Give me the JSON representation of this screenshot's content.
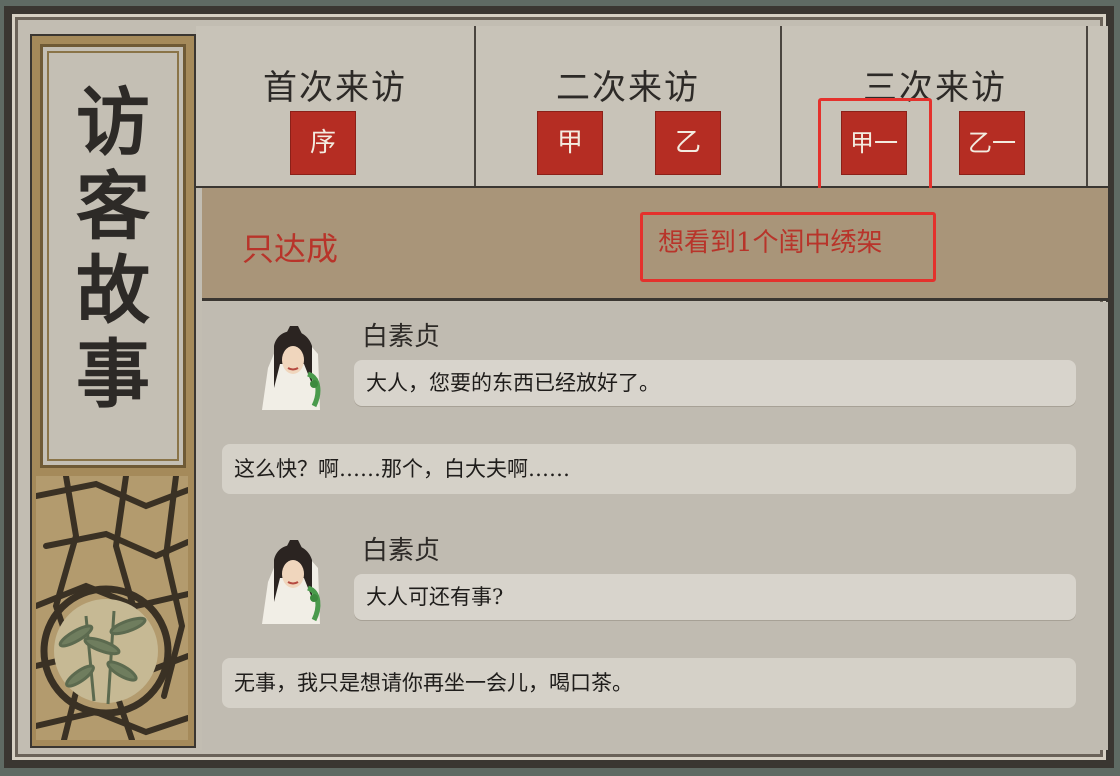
{
  "panel": {
    "title": "访\n客\n故\n事"
  },
  "visits": [
    {
      "title": "首次来访",
      "buttons": [
        "序"
      ]
    },
    {
      "title": "二次来访",
      "buttons": [
        "甲",
        "乙"
      ]
    },
    {
      "title": "三次来访",
      "buttons": [
        "甲一",
        "乙一"
      ]
    }
  ],
  "requirement": {
    "label": "只达成",
    "target": "想看到1个闺中绣架"
  },
  "dialogue": [
    {
      "speaker": "白素贞",
      "line": "大人，您要的东西已经放好了。",
      "reply": "这么快？啊……那个，白大夫啊……"
    },
    {
      "speaker": "白素贞",
      "line": "大人可还有事?",
      "reply": "无事，我只是想请你再坐一会儿，喝口茶。"
    }
  ],
  "colors": {
    "stamp": "#b52d23",
    "highlight": "#e4312c",
    "requirement_text": "#b8342a"
  },
  "icons": {
    "avatar": "white-snake-portrait",
    "lattice": "window-lattice-ornament"
  }
}
